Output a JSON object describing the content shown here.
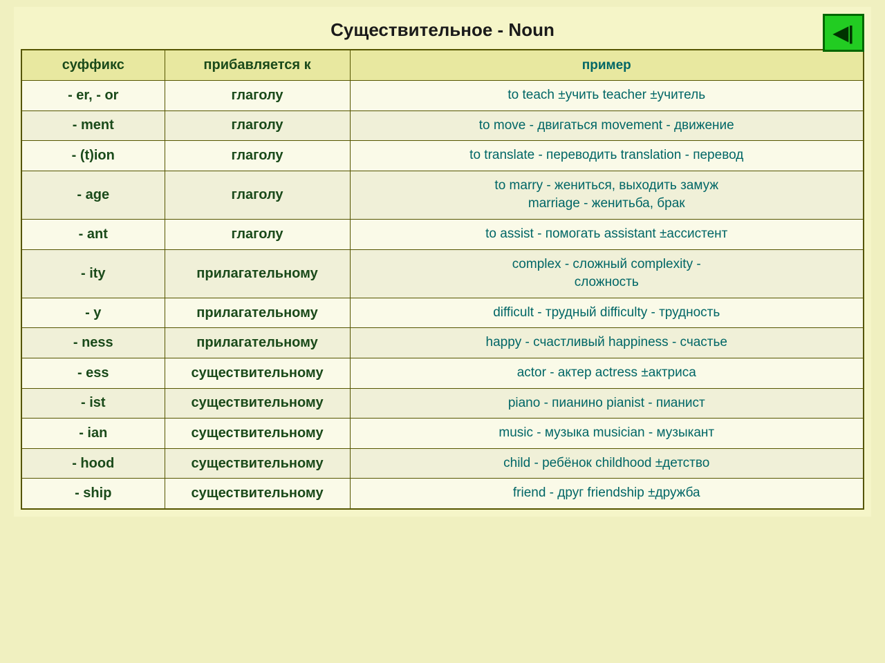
{
  "title": "Существительное - Noun",
  "nav_button": "◀|",
  "header": {
    "col1": "суффикс",
    "col2": "прибавляется к",
    "col3": "пример"
  },
  "rows": [
    {
      "suffix": "- er, - or",
      "added_to": "глаголу",
      "example_lines": [
        "to teach ±учить          teacher ±учитель"
      ]
    },
    {
      "suffix": "- ment",
      "added_to": "глаголу",
      "example_lines": [
        "to move - двигаться  movement - движение"
      ]
    },
    {
      "suffix": "- (t)ion",
      "added_to": "глаголу",
      "example_lines": [
        "to translate - переводить  translation - перевод"
      ]
    },
    {
      "suffix": "- age",
      "added_to": "глаголу",
      "example_lines": [
        "to marry - жениться, выходить замуж",
        "marriage - женитьба, брак"
      ]
    },
    {
      "suffix": "- ant",
      "added_to": "глаголу",
      "example_lines": [
        "to assist - помогать     assistant ±ассистент"
      ]
    },
    {
      "suffix": "- ity",
      "added_to": "прилагательному",
      "example_lines": [
        "complex - сложный   complexity -",
        "сложность"
      ]
    },
    {
      "suffix": "- y",
      "added_to": "прилагательному",
      "example_lines": [
        "difficult - трудный     difficulty - трудность"
      ]
    },
    {
      "suffix": "- ness",
      "added_to": "прилагательному",
      "example_lines": [
        "happy - счастливый     happiness - счастье"
      ]
    },
    {
      "suffix": "- ess",
      "added_to": "существительному",
      "example_lines": [
        "actor - актер             actress ±актриса"
      ]
    },
    {
      "suffix": "- ist",
      "added_to": "существительному",
      "example_lines": [
        "piano - пианино          pianist - пианист"
      ]
    },
    {
      "suffix": "- ian",
      "added_to": "существительному",
      "example_lines": [
        "music - музыка        musician - музыкант"
      ]
    },
    {
      "suffix": "- hood",
      "added_to": "существительному",
      "example_lines": [
        "child - ребёнок         childhood ±детство"
      ]
    },
    {
      "suffix": "- ship",
      "added_to": "существительному",
      "example_lines": [
        "friend - друг            friendship ±дружба"
      ]
    }
  ]
}
